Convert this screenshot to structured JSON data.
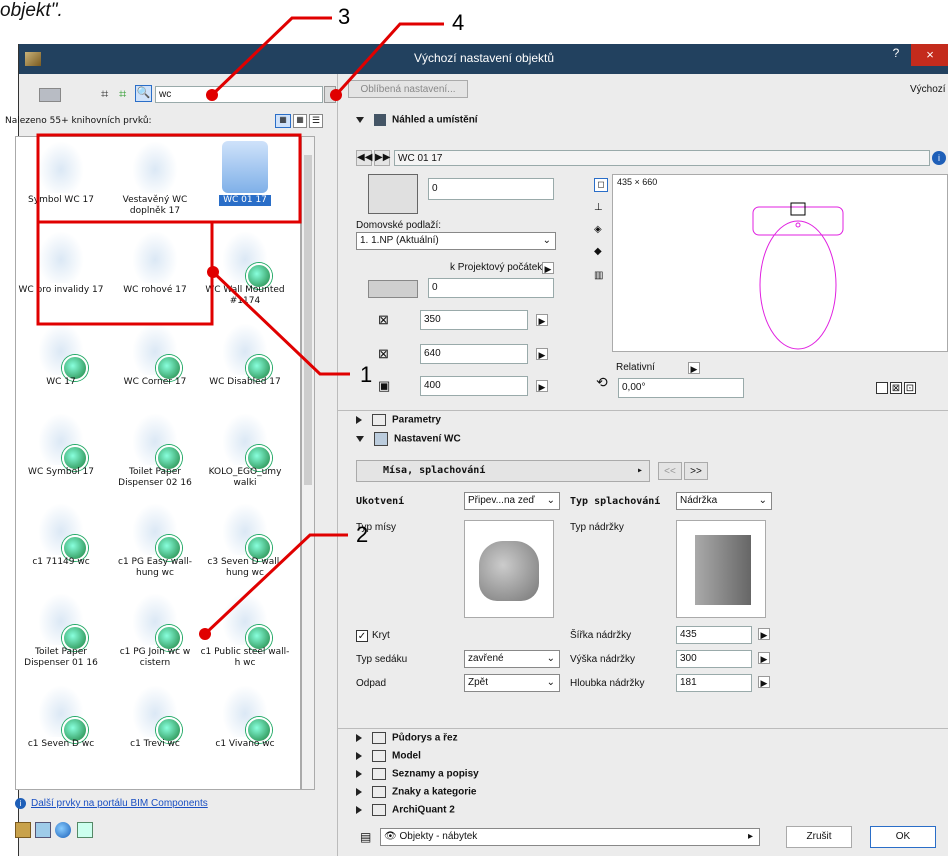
{
  "top_note": "objekt\".",
  "window": {
    "title": "Výchozí nastavení objektů",
    "help": "?",
    "close": "×"
  },
  "left": {
    "search_value": "wc",
    "found_label": "Nalezeno 55+ knihovních prvků:",
    "items": [
      {
        "label": "Symbol WC 17"
      },
      {
        "label": "Vestavěný WC doplněk 17"
      },
      {
        "label": "WC 01 17"
      },
      {
        "label": "WC pro invalidy 17"
      },
      {
        "label": "WC rohové 17"
      },
      {
        "label": "WC Wall Mounted #1174"
      },
      {
        "label": "WC 17"
      },
      {
        "label": "WC Corner 17"
      },
      {
        "label": "WC Disabled 17"
      },
      {
        "label": "WC Symbol 17"
      },
      {
        "label": "Toilet Paper Dispenser 02 16"
      },
      {
        "label": "KOLO_EGO_umy walki"
      },
      {
        "label": "c1 71149 wc"
      },
      {
        "label": "c1 PG Easy wall-hung wc"
      },
      {
        "label": "c3 Seven D wall-hung wc"
      },
      {
        "label": "Toilet Paper Dispenser 01 16"
      },
      {
        "label": "c1 PG Join wc w cistern"
      },
      {
        "label": "c1 Public steel wall-h wc"
      },
      {
        "label": "c1 Seven D wc"
      },
      {
        "label": "c1 Trevi wc"
      },
      {
        "label": "c1 Vivano wc"
      }
    ],
    "bim_link": "Další prvky na portálu BIM Components"
  },
  "right": {
    "favorites_button": "Oblíbená nastavení...",
    "top_right_label": "Výchozí",
    "section_preview": "Náhled a umístění",
    "object_name": "WC 01 17",
    "elev_value": "0",
    "home_story_label": "Domovské podlaží:",
    "home_story_value": "1. 1.NP (Aktuální)",
    "project_zero_label": "k Projektový počátek",
    "elev2_value": "0",
    "dim_a": "350",
    "dim_b": "640",
    "dim_c": "400",
    "preview_size": "435 × 660",
    "relative_label": "Relativní",
    "angle_value": "0,00°",
    "section_params": "Parametry",
    "section_wc": "Nastavení WC",
    "page_dropdown": "Mísa, splachování",
    "nav_prev": "<<",
    "nav_next": ">>",
    "anchor_label": "Ukotvení",
    "anchor_value": "Připev...na zeď",
    "flush_type_label": "Typ splachování",
    "flush_type_value": "Nádržka",
    "bowl_type_label": "Typ mísy",
    "tank_type_label": "Typ nádržky",
    "cover_label": "Kryt",
    "seat_type_label": "Typ sedáku",
    "seat_type_value": "zavřené",
    "drain_label": "Odpad",
    "drain_value": "Zpět",
    "tank_width_label": "Šířka nádržky",
    "tank_width_value": "435",
    "tank_height_label": "Výška nádržky",
    "tank_height_value": "300",
    "tank_depth_label": "Hloubka nádržky",
    "tank_depth_value": "181",
    "sections_collapsed": [
      "Půdorys a řez",
      "Model",
      "Seznamy a popisy",
      "Znaky a kategorie",
      "ArchiQuant 2"
    ],
    "layer_value": "Objekty - nábytek",
    "cancel": "Zrušit",
    "ok": "OK"
  },
  "annotations": {
    "n1": "1",
    "n2": "2",
    "n3": "3",
    "n4": "4"
  },
  "colors": {
    "titlebar": "#22415f",
    "close": "#c42b1c",
    "annotation": "#e00000"
  }
}
